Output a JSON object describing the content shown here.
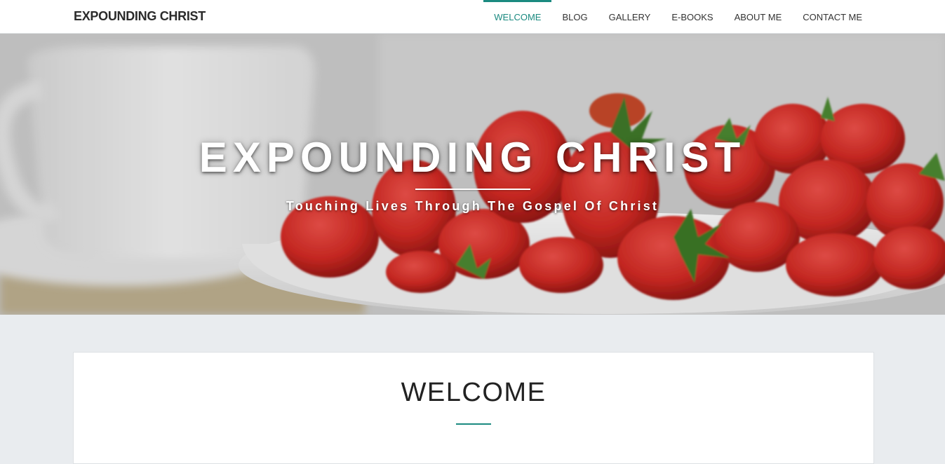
{
  "site": {
    "title": "EXPOUNDING CHRIST"
  },
  "nav": {
    "items": [
      {
        "label": "WELCOME",
        "active": true
      },
      {
        "label": "BLOG",
        "active": false
      },
      {
        "label": "GALLERY",
        "active": false
      },
      {
        "label": "E-BOOKS",
        "active": false
      },
      {
        "label": "ABOUT ME",
        "active": false
      },
      {
        "label": "CONTACT ME",
        "active": false
      }
    ]
  },
  "hero": {
    "title": "EXPOUNDING CHRIST",
    "tagline": "Touching Lives Through The Gospel Of Christ"
  },
  "main": {
    "heading": "WELCOME"
  },
  "colors": {
    "accent": "#1b8a80",
    "header_bg": "#ffffff",
    "page_bg": "#e9ecef",
    "text": "#2b2b2b"
  }
}
